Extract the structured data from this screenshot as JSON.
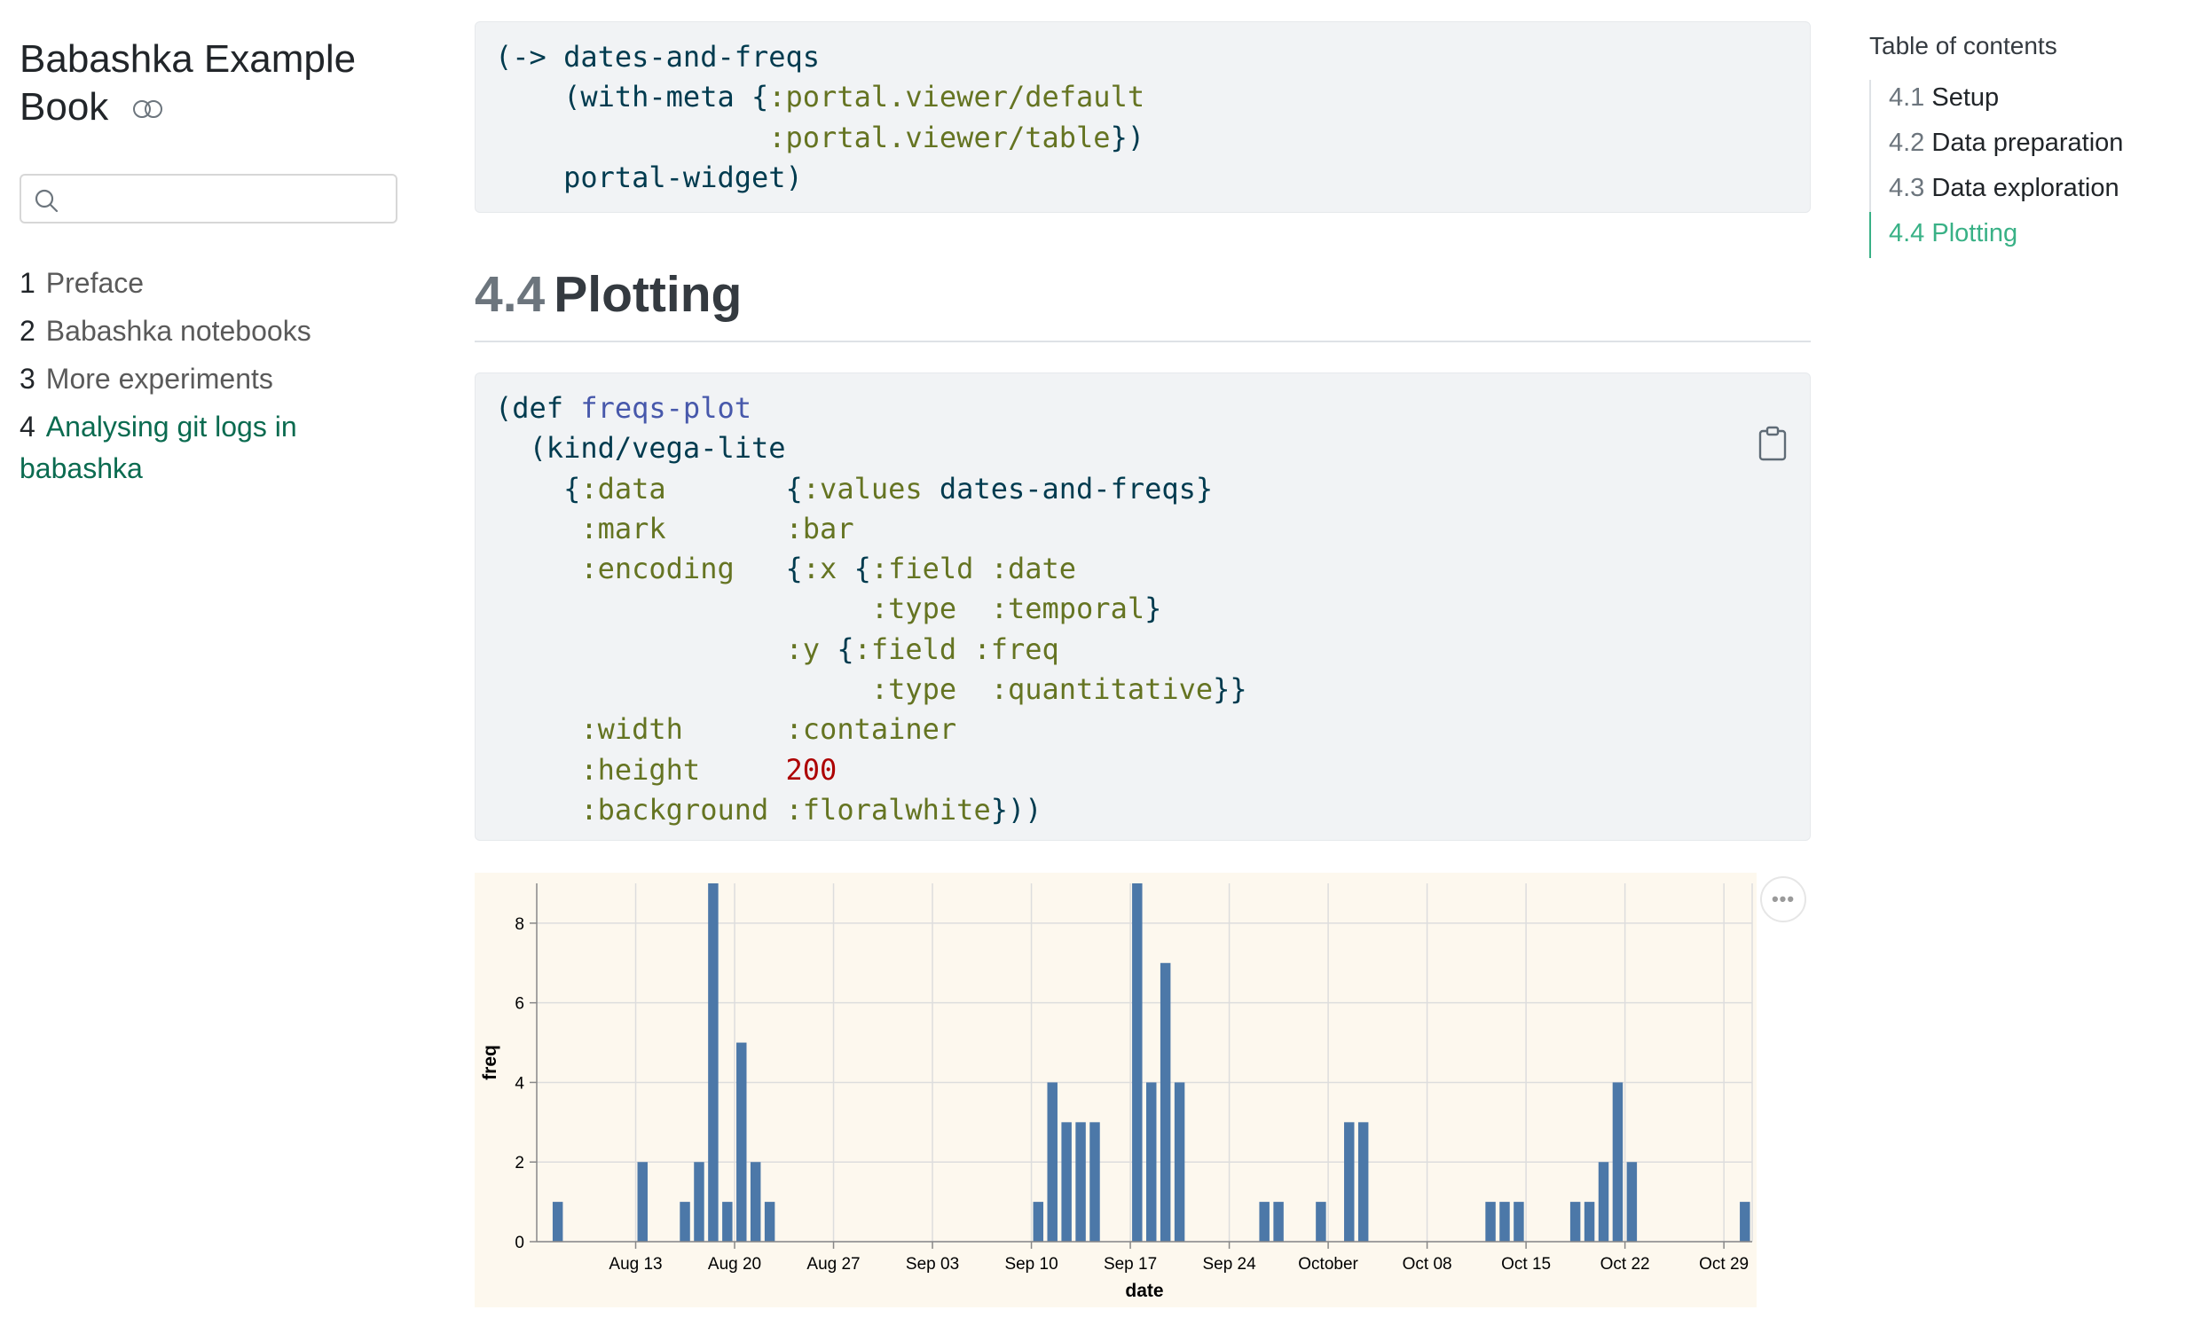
{
  "sidebar": {
    "title": "Babashka Example Book",
    "search": {
      "placeholder": ""
    },
    "nav": [
      {
        "num": "1",
        "label": "Preface"
      },
      {
        "num": "2",
        "label": "Babashka notebooks"
      },
      {
        "num": "3",
        "label": "More experiments"
      },
      {
        "num": "4",
        "label": "Analysing git logs in babashka",
        "active": true
      }
    ]
  },
  "code1": {
    "lines": [
      "(-> dates-and-freqs",
      "    (with-meta {:portal.viewer/default",
      "                :portal.viewer/table})",
      "    portal-widget)"
    ]
  },
  "section": {
    "number": "4.4",
    "title": "Plotting"
  },
  "code2": {
    "lines": [
      "(def freqs-plot",
      "  (kind/vega-lite",
      "    {:data       {:values dates-and-freqs}",
      "     :mark       :bar",
      "     :encoding   {:x {:field :date",
      "                      :type  :temporal}",
      "                 :y {:field :freq",
      "                      :type  :quantitative}}",
      "     :width      :container",
      "     :height     200",
      "     :background :floralwhite}))"
    ]
  },
  "toc": {
    "title": "Table of contents",
    "items": [
      {
        "num": "4.1",
        "label": "Setup"
      },
      {
        "num": "4.2",
        "label": "Data preparation"
      },
      {
        "num": "4.3",
        "label": "Data exploration"
      },
      {
        "num": "4.4",
        "label": "Plotting",
        "active": true
      }
    ]
  },
  "colors": {
    "bar": "#4c78a8",
    "chart_background": "#fdf8ee",
    "accent": "#39b186",
    "nav_active": "#0b6b50"
  },
  "chart_data": {
    "type": "bar",
    "xlabel": "date",
    "ylabel": "freq",
    "ylim": [
      0,
      9
    ],
    "yticks": [
      0,
      2,
      4,
      6,
      8
    ],
    "xticks": [
      "Aug 13",
      "Aug 20",
      "Aug 27",
      "Sep 03",
      "Sep 10",
      "Sep 17",
      "Sep 24",
      "October",
      "Oct 08",
      "Oct 15",
      "Oct 22",
      "Oct 29"
    ],
    "grid": true,
    "series": [
      {
        "x": [
          "2023-08-07",
          "2023-08-13",
          "2023-08-16",
          "2023-08-17",
          "2023-08-18",
          "2023-08-19",
          "2023-08-20",
          "2023-08-21",
          "2023-08-22",
          "2023-09-10",
          "2023-09-11",
          "2023-09-12",
          "2023-09-13",
          "2023-09-14",
          "2023-09-17",
          "2023-09-18",
          "2023-09-19",
          "2023-09-20",
          "2023-09-26",
          "2023-09-27",
          "2023-09-30",
          "2023-10-02",
          "2023-10-03",
          "2023-10-12",
          "2023-10-13",
          "2023-10-14",
          "2023-10-18",
          "2023-10-19",
          "2023-10-20",
          "2023-10-21",
          "2023-10-22",
          "2023-10-30"
        ],
        "values": [
          1,
          2,
          1,
          2,
          9,
          1,
          5,
          2,
          1,
          1,
          4,
          3,
          3,
          3,
          9,
          4,
          7,
          4,
          1,
          1,
          1,
          3,
          3,
          1,
          1,
          1,
          1,
          1,
          2,
          4,
          2,
          1
        ]
      }
    ]
  }
}
